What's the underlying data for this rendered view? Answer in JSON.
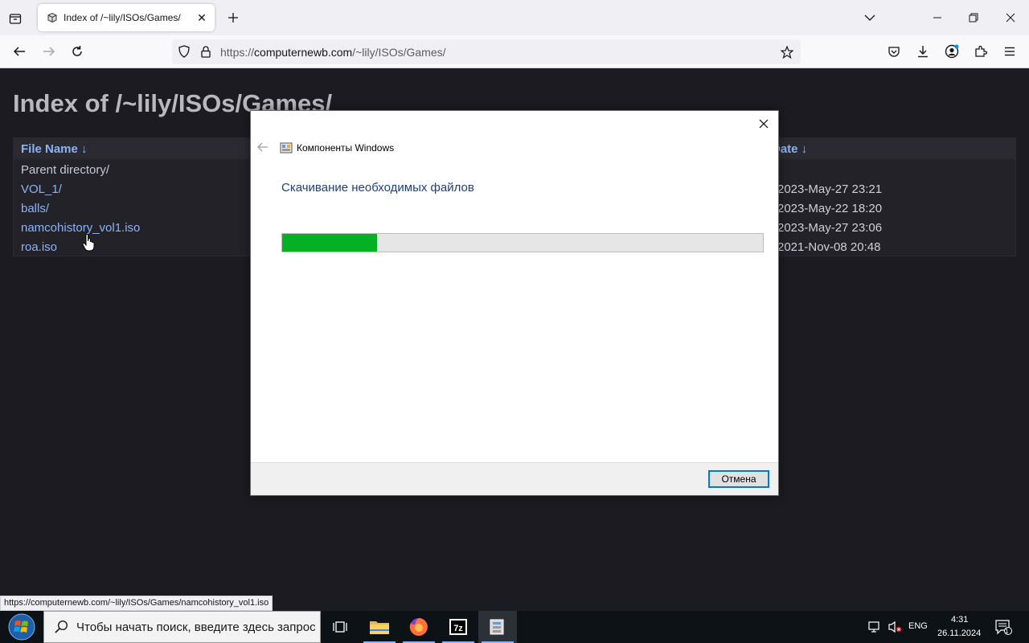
{
  "browser": {
    "tab_title": "Index of /~lily/ISOs/Games/",
    "tab_close": "✕",
    "url_prefix": "https://",
    "url_domain": "computernewb.com",
    "url_path": "/~lily/ISOs/Games/",
    "status_link": "https://computernewb.com/~lily/ISOs/Games/namcohistory_vol1.iso"
  },
  "page": {
    "heading": "Index of /~lily/ISOs/Games/",
    "col_name": "File Name  ↓",
    "col_date": "Date  ↓",
    "rows": [
      {
        "name": "Parent directory/",
        "date": ""
      },
      {
        "name": "VOL_1/",
        "date": "2023-May-27 23:21"
      },
      {
        "name": "balls/",
        "date": "2023-May-22 18:20"
      },
      {
        "name": "namcohistory_vol1.iso",
        "date": "2023-May-27 23:06"
      },
      {
        "name": "roa.iso",
        "date": "2021-Nov-08 20:48"
      }
    ]
  },
  "dialog": {
    "caption": "Компоненты Windows",
    "heading": "Скачивание необходимых файлов",
    "progress_fraction": 0.198,
    "cancel_label": "Отмена"
  },
  "taskbar": {
    "search_placeholder": "Чтобы начать поиск, введите здесь запрос",
    "lang": "ENG",
    "time": "4:31",
    "date": "26.11.2024",
    "notif_count": "1",
    "apps": [
      "task-view-icon",
      "file-explorer-icon",
      "firefox-icon",
      "7zip-icon",
      "windows-features-icon"
    ]
  },
  "colors": {
    "page_bg": "#1c1b22",
    "link": "#8ab4f8",
    "progress": "#06b025",
    "dialog_heading": "#1e3e79"
  }
}
